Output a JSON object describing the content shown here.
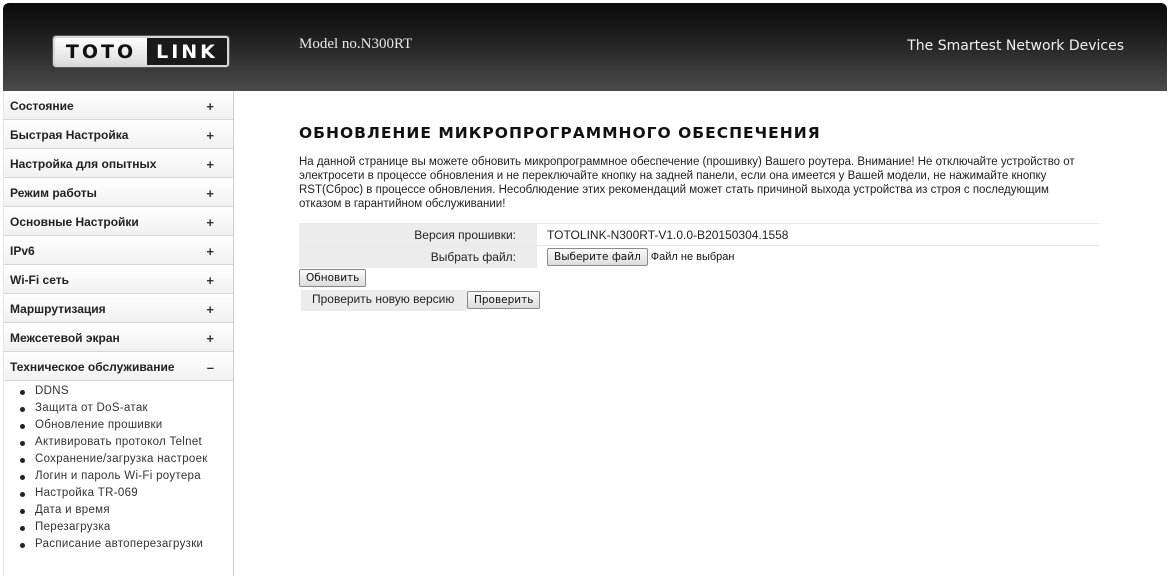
{
  "header": {
    "logo_left": "TOTO",
    "logo_right": "LINK",
    "model": "Model no.N300RT",
    "slogan": "The Smartest Network Devices"
  },
  "sidebar": {
    "items": [
      {
        "label": "Состояние",
        "sign": "+"
      },
      {
        "label": "Быстрая Настройка",
        "sign": "+"
      },
      {
        "label": "Настройка для опытных",
        "sign": "+"
      },
      {
        "label": "Режим работы",
        "sign": "+"
      },
      {
        "label": "Основные Настройки",
        "sign": "+"
      },
      {
        "label": "IPv6",
        "sign": "+"
      },
      {
        "label": "Wi-Fi сеть",
        "sign": "+"
      },
      {
        "label": "Маршрутизация",
        "sign": "+"
      },
      {
        "label": "Межсетевой экран",
        "sign": "+"
      },
      {
        "label": "Техническое обслуживание",
        "sign": "–"
      }
    ],
    "subitems": [
      "DDNS",
      "Защита от DoS-атак",
      "Обновление прошивки",
      "Активировать протокол Telnet",
      "Сохранение/загрузка настроек",
      "Логин и пароль Wi-Fi роутера",
      "Настройка TR-069",
      "Дата и время",
      "Перезагрузка",
      "Расписание автоперезагрузки"
    ]
  },
  "main": {
    "title": "ОБНОВЛЕНИЕ МИКРОПРОГРАММНОГО ОБЕСПЕЧЕНИЯ",
    "description": "На данной странице вы можете обновить микропрограммное обеспечение (прошивку) Вашего роутера. Внимание! Не отключайте устройство от электросети в процессе обновления и не переключайте кнопку на задней панели, если она имеется у Вашей модели, не нажимайте кнопку RST(Сброс) в процессе обновления. Несоблюдение этих рекомендаций может стать причиной выхода устройства из строя с последующим отказом в гарантийном обслуживании!",
    "firmware_label": "Версия прошивки:",
    "firmware_value": "TOTOLINK-N300RT-V1.0.0-B20150304.1558",
    "file_label": "Выбрать файл:",
    "choose_file_button": "Выберите файл",
    "no_file_text": "Файл не выбран",
    "update_button": "Обновить",
    "check_label": "Проверить новую версию",
    "check_button": "Проверить"
  }
}
